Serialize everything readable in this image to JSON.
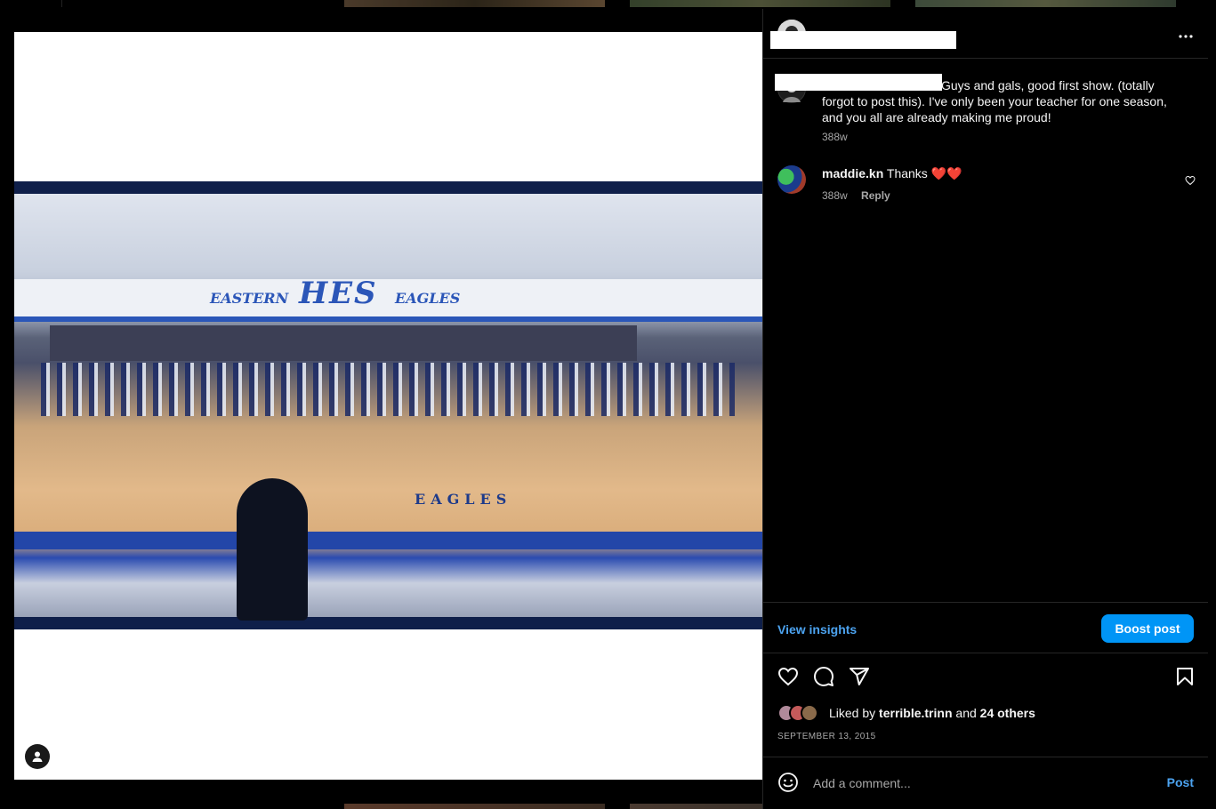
{
  "window": {
    "scrollbar": ""
  },
  "post": {
    "author": "",
    "caption": "Guys and gals, good first show. (totally forgot to post this). I've only been your teacher for one season, and you all are already making me proud!",
    "caption_time": "388w",
    "more_icon": "more-horizontal-icon"
  },
  "photo": {
    "logo_text": "HES",
    "banner_left": "EASTERN",
    "banner_right": "EAGLES",
    "floor_text": "EAGLES"
  },
  "comments": [
    {
      "username": "maddie.kn",
      "text": "Thanks ❤️❤️",
      "time": "388w",
      "reply_label": "Reply"
    }
  ],
  "insights": {
    "view_label": "View insights",
    "boost_label": "Boost post"
  },
  "likes": {
    "prefix": "Liked by",
    "user": "terrible.trinn",
    "joiner": "and",
    "others": "24 others"
  },
  "date": "SEPTEMBER 13, 2015",
  "composer": {
    "placeholder": "Add a comment...",
    "post_label": "Post"
  },
  "colors": {
    "accent": "#0095f6",
    "link": "#4ca3f0",
    "background": "#000000"
  }
}
